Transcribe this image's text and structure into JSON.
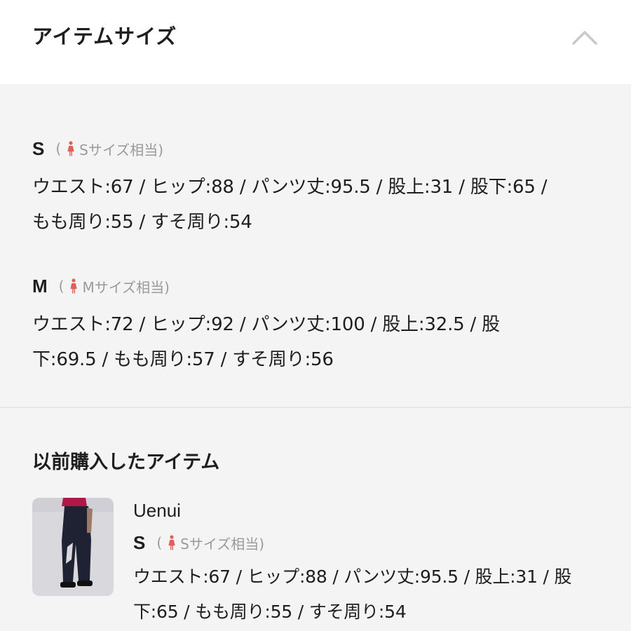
{
  "header": {
    "title": "アイテムサイズ"
  },
  "sizes": [
    {
      "letter": "S",
      "note_prefix": "(",
      "note_text": "Sサイズ相当)",
      "line1": "ウエスト:67 / ヒップ:88 / パンツ丈:95.5 / 股上:31 / 股下:65 /",
      "line2": "もも周り:55 / すそ周り:54"
    },
    {
      "letter": "M",
      "note_prefix": "(",
      "note_text": "Mサイズ相当)",
      "line1": "ウエスト:72 / ヒップ:92 / パンツ丈:100 / 股上:32.5 / 股",
      "line2": "下:69.5 / もも周り:57 / すそ周り:56"
    }
  ],
  "previous": {
    "title": "以前購入したアイテム",
    "brand": "Uenui",
    "letter": "S",
    "note_prefix": "(",
    "note_text": "Sサイズ相当)",
    "line1": "ウエスト:67 / ヒップ:88 / パンツ丈:95.5 / 股上:31 / 股",
    "line2": "下:65 / もも周り:55 / すそ周り:54"
  },
  "colors": {
    "accent_icon": "#e0605a",
    "note_gray": "#9a9a9a",
    "text": "#1e1e1e"
  }
}
